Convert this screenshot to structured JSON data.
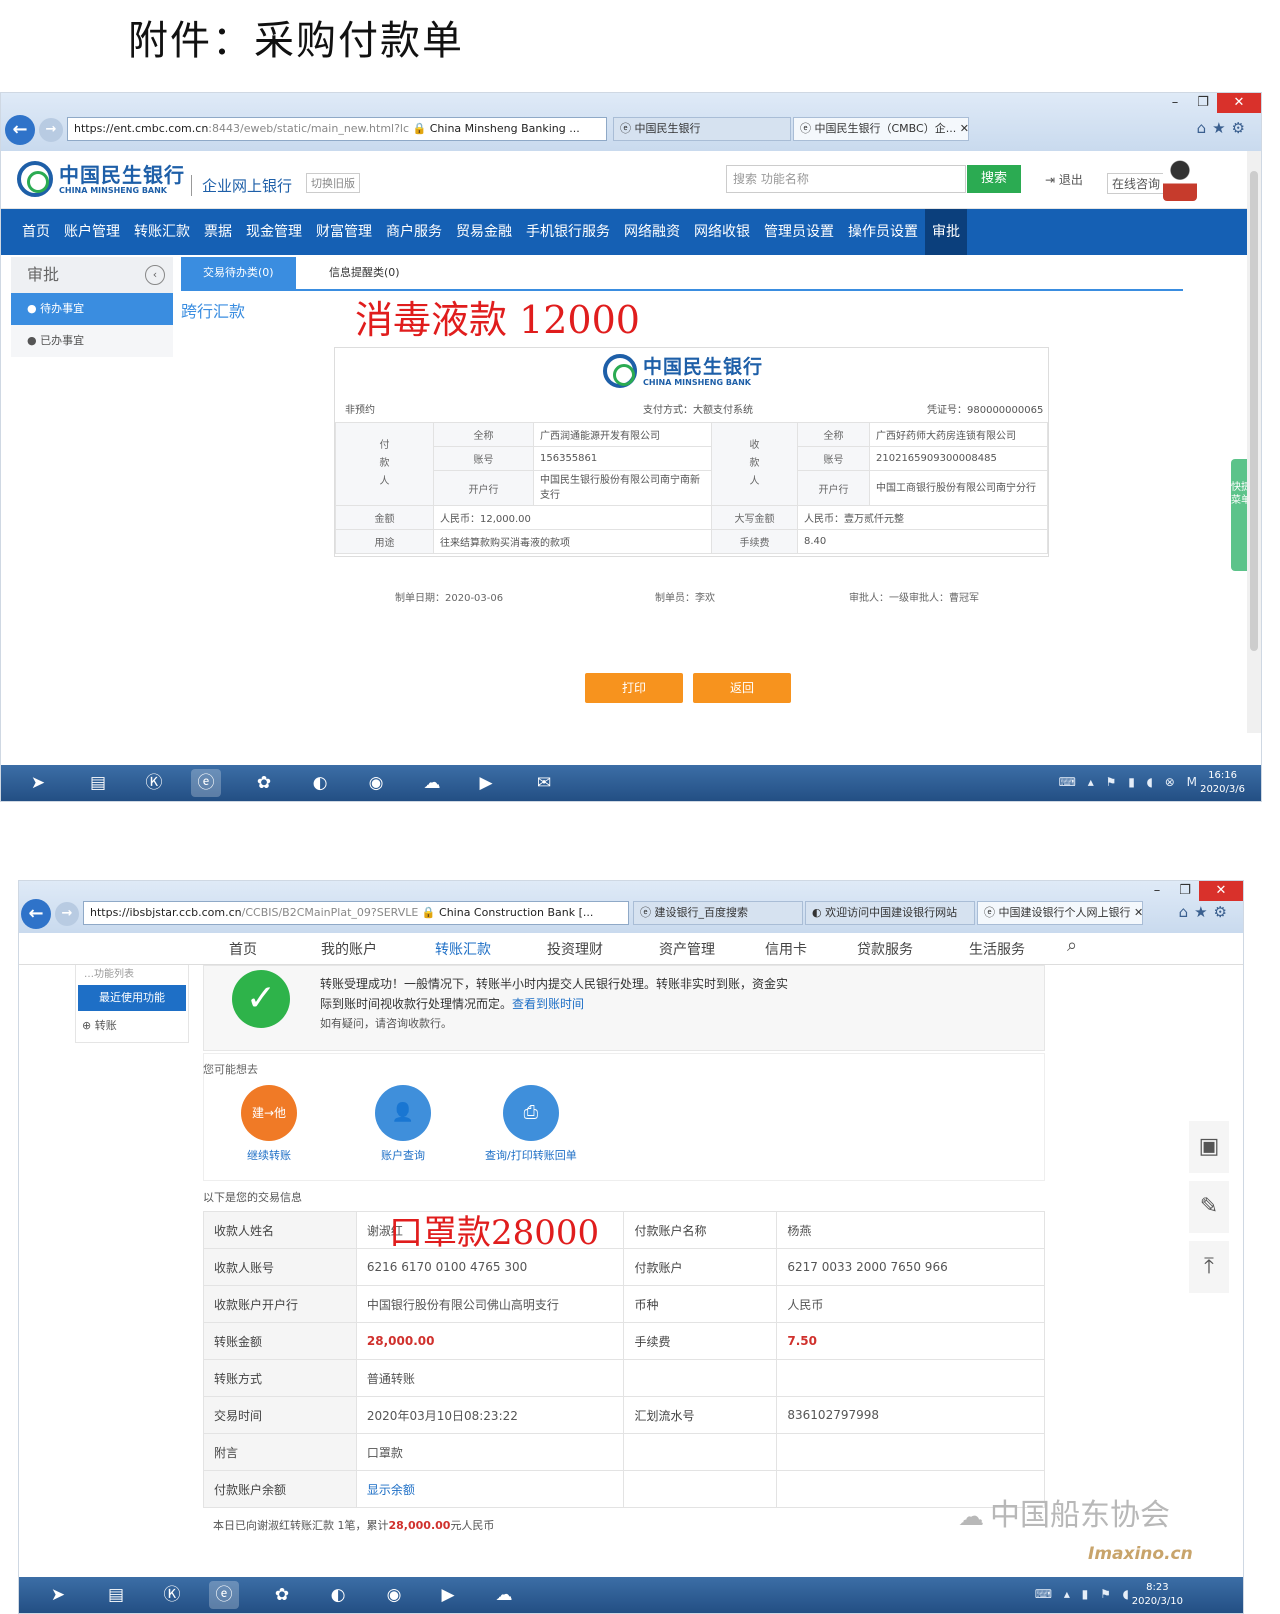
{
  "page": {
    "title": "附件：采购付款单"
  },
  "shot1": {
    "browser": {
      "url_prefix": "https://",
      "url_host": "ent.cmbc.com.cn",
      "url_rest": ":8443/eweb/static/main_new.html?lc",
      "site_label": "China Minsheng Banking ...",
      "tabs": [
        "中国民生银行",
        "中国民生银行（CMBC）企..."
      ]
    },
    "header": {
      "logo_cn": "中国民生银行",
      "logo_en": "CHINA MINSHENG BANK",
      "corp_label": "企业网上银行",
      "switch_label": "切换旧版",
      "search_placeholder": "搜索 功能名称",
      "search_button": "搜索",
      "logout": "退出",
      "consult": "在线咨询"
    },
    "nav": [
      "首页",
      "账户管理",
      "转账汇款",
      "票据",
      "现金管理",
      "财富管理",
      "商户服务",
      "贸易金融",
      "手机银行服务",
      "网络融资",
      "网络收银",
      "管理员设置",
      "操作员设置",
      "审批"
    ],
    "sidebar": {
      "title": "审批",
      "items": [
        "● 待办事宜",
        "● 已办事宜"
      ]
    },
    "tabs": [
      "交易待办类(0)",
      "信息提醒类(0)"
    ],
    "section_title": "跨行汇款",
    "annotation": "消毒液款 12000",
    "voucher": {
      "reserve_label": "非预约",
      "pay_method": "支付方式：大额支付系统",
      "voucher_no": "凭证号：980000000065",
      "payer_label": "付\n款\n人",
      "payee_label": "收\n款\n人",
      "payer": {
        "name_k": "全称",
        "name": "广西润通能源开发有限公司",
        "acct_k": "账号",
        "acct": "156355861",
        "bank_k": "开户行",
        "bank": "中国民生银行股份有限公司南宁南新支行"
      },
      "payee": {
        "name_k": "全称",
        "name": "广西好药师大药房连锁有限公司",
        "acct_k": "账号",
        "acct": "2102165909300008485",
        "bank_k": "开户行",
        "bank": "中国工商银行股份有限公司南宁分行"
      },
      "amount_k": "金额",
      "amount": "人民币：12,000.00",
      "amount_upper_k": "大写金额",
      "amount_upper": "人民币：壹万贰仟元整",
      "purpose_k": "用途",
      "purpose": "往来结算款购买消毒液的款项",
      "fee_k": "手续费",
      "fee": "8.40"
    },
    "footer": {
      "date": "制单日期：2020-03-06",
      "maker": "制单员：李欢",
      "approver": "审批人：一级审批人：曹冠军"
    },
    "buttons": {
      "print": "打印",
      "back": "返回"
    },
    "quick_menu": "快捷菜单",
    "clock": {
      "time": "16:16",
      "date": "2020/3/6"
    }
  },
  "shot2": {
    "browser": {
      "url_prefix": "https://",
      "url_host": "ibsbjstar.ccb.com.cn",
      "url_rest": "/CCBIS/B2CMainPlat_09?SERVLE",
      "site_label": "China Construction Bank [...",
      "tabs": [
        "建设银行_百度搜索",
        "欢迎访问中国建设银行网站",
        "中国建设银行个人网上银行"
      ]
    },
    "nav": [
      "首页",
      "我的账户",
      "转账汇款",
      "投资理财",
      "资产管理",
      "信用卡",
      "贷款服务",
      "生活服务"
    ],
    "sidebar": {
      "faded": "…功能列表",
      "shortcut": "最近使用功能",
      "transfer": "⊕ 转账"
    },
    "success": {
      "line1": "转账受理成功！一般情况下，转账半小时内提交人民银行处理。转账非实时到账，资金实",
      "line2": "际到账时间视收款行处理情况而定。",
      "link": "查看到账时间",
      "line3": "如有疑问，请咨询收款行。"
    },
    "next_title": "您可能想去",
    "actions": [
      "继续转账",
      "账户查询",
      "查询/打印转账回单"
    ],
    "action_icon_text": "建→他",
    "info_title": "以下是您的交易信息",
    "annotation": "口罩款28000",
    "rows": [
      [
        "收款人姓名",
        "谢淑红",
        "付款账户名称",
        "杨燕"
      ],
      [
        "收款人账号",
        "6216 6170 0100 4765 300",
        "付款账户",
        "6217 0033 2000 7650 966"
      ],
      [
        "收款账户开户行",
        "中国银行股份有限公司佛山高明支行",
        "币种",
        "人民币"
      ],
      [
        "转账金额",
        "28,000.00",
        "手续费",
        "7.50"
      ],
      [
        "转账方式",
        "普通转账",
        "",
        ""
      ],
      [
        "交易时间",
        "2020年03月10日08:23:22",
        "汇划流水号",
        "836102797998"
      ],
      [
        "附言",
        "口罩款",
        "",
        ""
      ],
      [
        "付款账户余额",
        "显示余额",
        "",
        ""
      ]
    ],
    "today_prefix": "本日已向谢淑红转账汇款 1笔，累计",
    "today_amount": "28,000.00",
    "today_suffix": "元人民币",
    "clock": {
      "time": "8:23",
      "date": "2020/3/10"
    }
  },
  "watermark": {
    "text": "中国船东协会",
    "site": "Imaxino.cn"
  }
}
